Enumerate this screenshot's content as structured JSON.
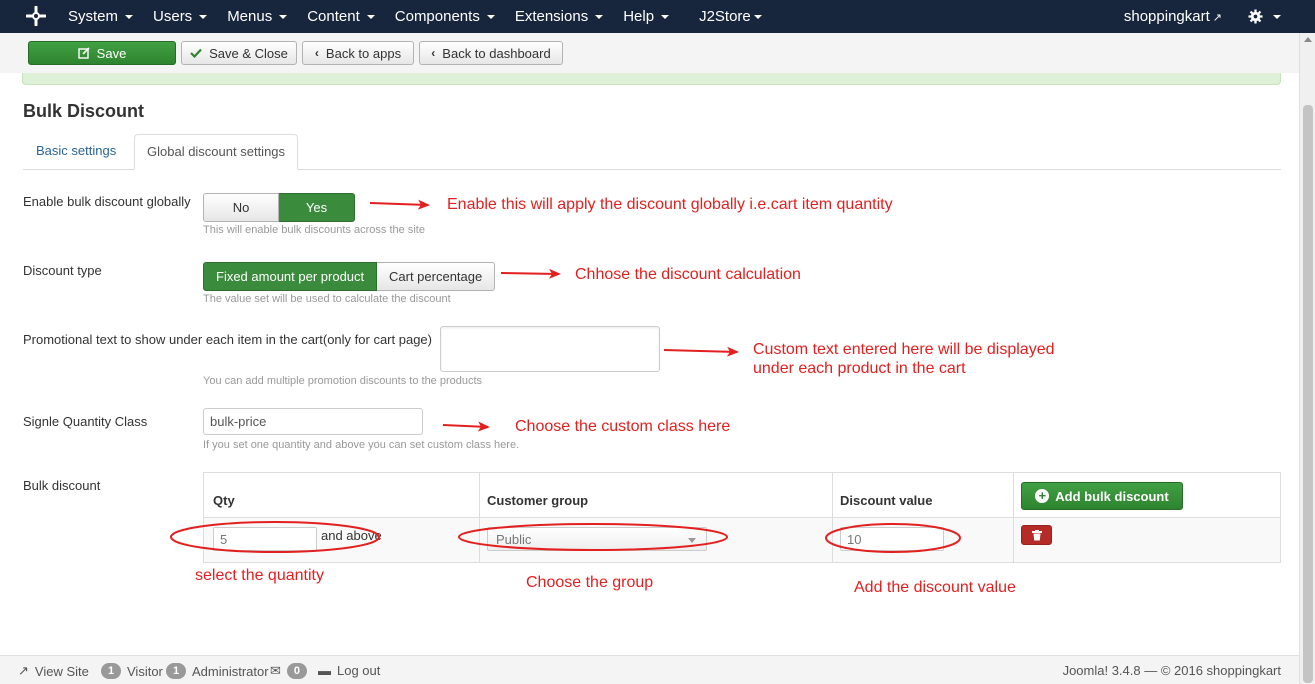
{
  "navbar": {
    "menu": [
      {
        "label": "System"
      },
      {
        "label": "Users"
      },
      {
        "label": "Menus"
      },
      {
        "label": "Content"
      },
      {
        "label": "Components"
      },
      {
        "label": "Extensions"
      },
      {
        "label": "Help"
      },
      {
        "label": "J2Store"
      }
    ],
    "site_link": "shoppingkart",
    "bg_color": "#17253d"
  },
  "toolbar": {
    "save": "Save",
    "save_close": "Save & Close",
    "back_apps": "Back to apps",
    "back_dashboard": "Back to dashboard"
  },
  "page": {
    "title": "Bulk Discount",
    "tabs": [
      {
        "label": "Basic settings",
        "active": false
      },
      {
        "label": "Global discount settings",
        "active": true
      }
    ]
  },
  "form": {
    "enable": {
      "label": "Enable bulk discount globally",
      "options": [
        "No",
        "Yes"
      ],
      "selected": "Yes",
      "help": "This will enable bulk discounts across the site"
    },
    "discount_type": {
      "label": "Discount type",
      "options": [
        "Fixed amount per product",
        "Cart percentage"
      ],
      "selected": "Fixed amount per product",
      "help": "The value set will be used to calculate the discount"
    },
    "promo_text": {
      "label": "Promotional text to show under each item in the cart(only for cart page)",
      "value": "",
      "help": "You can add multiple promotion discounts to the products"
    },
    "qty_class": {
      "label": "Signle Quantity Class",
      "value": "bulk-price",
      "help": "If you set one quantity and above you can set custom class here."
    },
    "bulk": {
      "label": "Bulk discount",
      "headers": {
        "qty": "Qty",
        "group": "Customer group",
        "value": "Discount value"
      },
      "add_button": "Add bulk discount",
      "rows": [
        {
          "qty": "5",
          "and_above": "and above",
          "group": "Public",
          "value": "10"
        }
      ]
    }
  },
  "annotations": {
    "enable": "Enable this will apply the discount globally i.e.cart item quantity",
    "type": "Chhose the discount calculation",
    "promo_line1": "Custom text entered here will be displayed",
    "promo_line2": "under each product in the cart",
    "class": "Choose the custom class here",
    "qty": "select the quantity",
    "group": "Choose the group",
    "value": "Add the discount value",
    "color": "#e32020"
  },
  "statusbar": {
    "view_site": "View Site",
    "visitor_count": "1",
    "visitor_label": "Visitor",
    "admin_count": "1",
    "admin_label": "Administrator",
    "messages_count": "0",
    "logout": "Log out",
    "footer": "Joomla! 3.4.8 — © 2016 shoppingkart"
  }
}
